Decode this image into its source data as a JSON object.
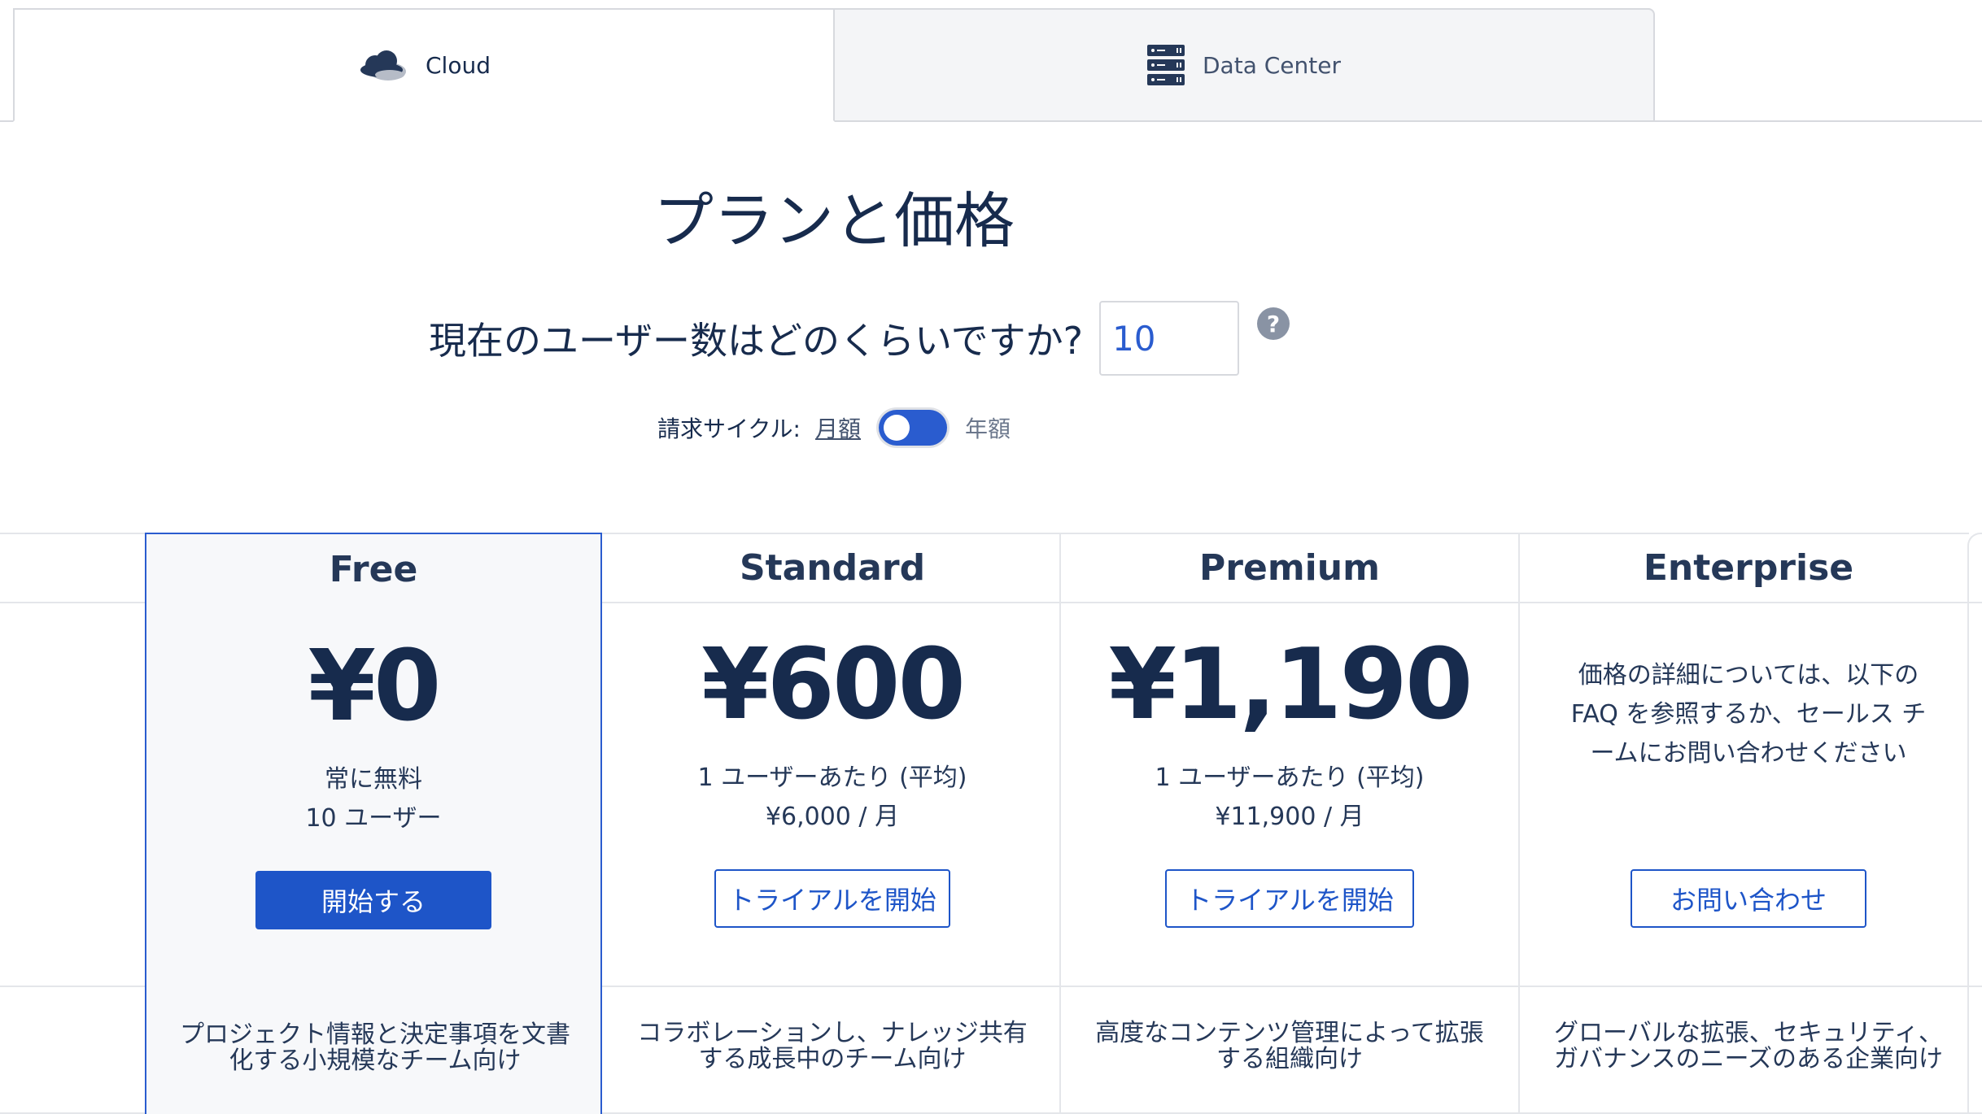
{
  "tabs": [
    {
      "label": "Cloud",
      "icon": "cloud-icon",
      "active": true
    },
    {
      "label": "Data Center",
      "icon": "server-icon",
      "active": false
    }
  ],
  "page_title": "プランと価格",
  "user_question": "現在のユーザー数はどのくらいですか?",
  "user_count": "10",
  "billing": {
    "label": "請求サイクル:",
    "monthly": "月額",
    "annual": "年額"
  },
  "plans": [
    {
      "name": "Free",
      "price": "¥0",
      "sub1": "常に無料",
      "sub2": "10 ユーザー",
      "button": "開始する",
      "description": "プロジェクト情報と決定事項を文書化する小規模なチーム向け"
    },
    {
      "name": "Standard",
      "price": "¥600",
      "sub1": "1 ユーザーあたり (平均)",
      "sub2": "¥6,000 / 月",
      "button": "トライアルを開始",
      "description": "コラボレーションし、ナレッジ共有する成長中のチーム向け"
    },
    {
      "name": "Premium",
      "price": "¥1,190",
      "sub1": "1 ユーザーあたり (平均)",
      "sub2": "¥11,900 / 月",
      "button": "トライアルを開始",
      "description": "高度なコンテンツ管理によって拡張する組織向け"
    },
    {
      "name": "Enterprise",
      "info": "価格の詳細については、以下の FAQ を参照するか、セールス チームにお問い合わせください",
      "button": "お問い合わせ",
      "description": "グローバルな拡張、セキュリティ、ガバナンスのニーズのある企業向け"
    }
  ],
  "colors": {
    "primary": "#1e55c8",
    "text": "#172b4d",
    "border": "#e4e6ea"
  }
}
